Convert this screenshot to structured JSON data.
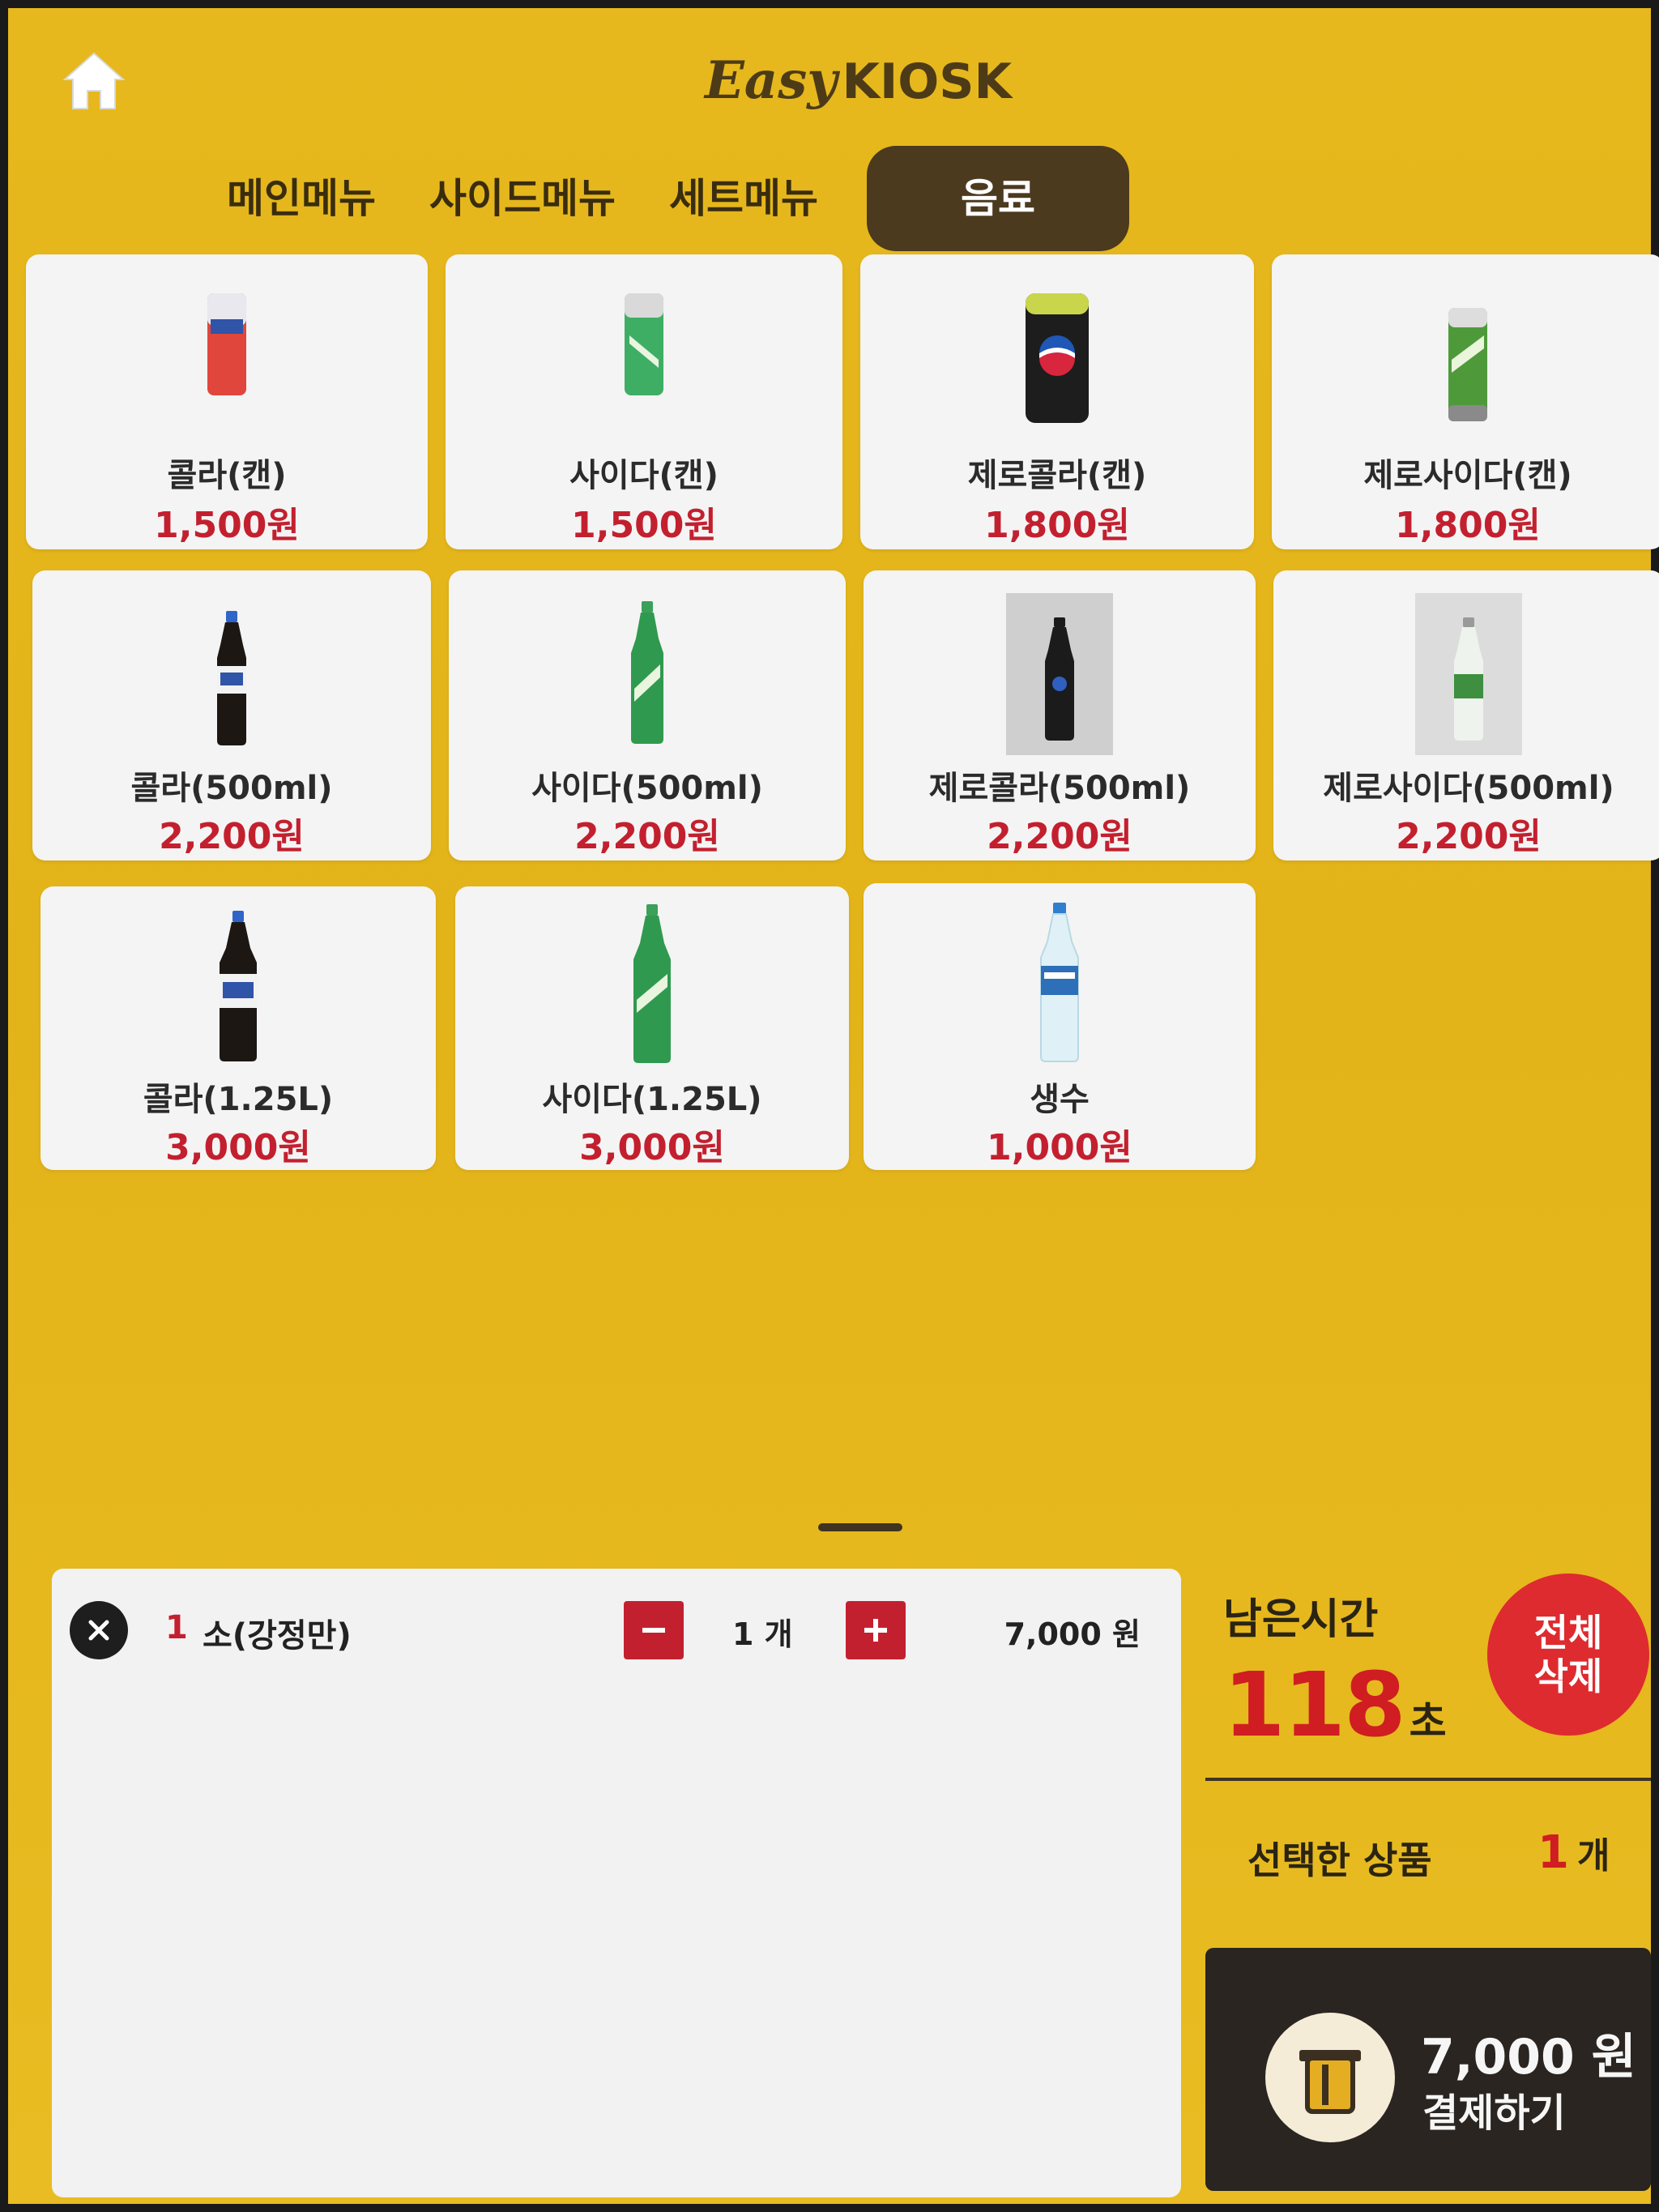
{
  "header": {
    "logo_easy": "Easy",
    "logo_kiosk": "KIOSK"
  },
  "tabs": [
    {
      "label": "메인메뉴",
      "active": false
    },
    {
      "label": "사이드메뉴",
      "active": false
    },
    {
      "label": "세트메뉴",
      "active": false
    },
    {
      "label": "음료",
      "active": true
    }
  ],
  "products": [
    {
      "name": "콜라(캔)",
      "price": "1,500원",
      "icon": "cola-can"
    },
    {
      "name": "사이다(캔)",
      "price": "1,500원",
      "icon": "cider-can"
    },
    {
      "name": "제로콜라(캔)",
      "price": "1,800원",
      "icon": "zero-cola-can"
    },
    {
      "name": "제로사이다(캔)",
      "price": "1,800원",
      "icon": "zero-cider-can"
    },
    {
      "name": "콜라(500ml)",
      "price": "2,200원",
      "icon": "cola-bottle"
    },
    {
      "name": "사이다(500ml)",
      "price": "2,200원",
      "icon": "cider-bottle"
    },
    {
      "name": "제로콜라(500ml)",
      "price": "2,200원",
      "icon": "zero-cola-bottle"
    },
    {
      "name": "제로사이다(500ml)",
      "price": "2,200원",
      "icon": "zero-cider-bottle"
    },
    {
      "name": "콜라(1.25L)",
      "price": "3,000원",
      "icon": "cola-large-bottle"
    },
    {
      "name": "사이다(1.25L)",
      "price": "3,000원",
      "icon": "cider-large-bottle"
    },
    {
      "name": "생수",
      "price": "1,000원",
      "icon": "water-bottle"
    }
  ],
  "cart": {
    "items": [
      {
        "index": "1",
        "name": "소(강정만)",
        "quantity": "1 개",
        "price": "7,000 원"
      }
    ]
  },
  "summary": {
    "timer_label": "남은시간",
    "timer_value": "118",
    "timer_unit": "초",
    "clear_line1": "전체",
    "clear_line2": "삭제",
    "selected_label": "선택한 상품",
    "selected_count": "1",
    "selected_unit": "개",
    "pay_amount": "7,000 원",
    "pay_label": "결제하기"
  },
  "colors": {
    "background": "#e6b81d",
    "accent_red": "#c3202f",
    "active_tab": "#4c3a1f",
    "pay_button": "#2a2520"
  }
}
